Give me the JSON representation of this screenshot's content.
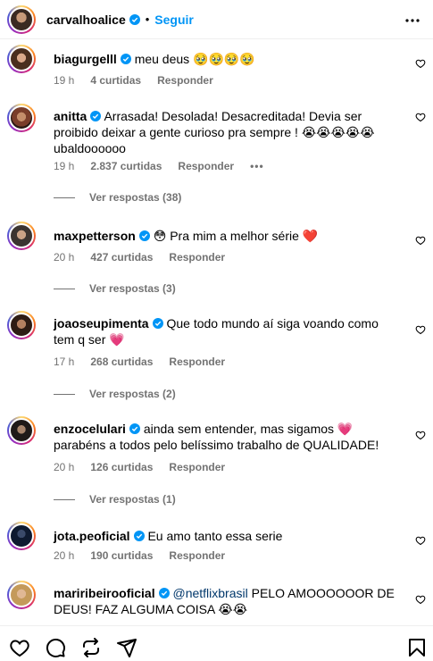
{
  "header": {
    "username": "carvalhoalice",
    "follow_label": "Seguir",
    "separator": "•"
  },
  "comments": [
    {
      "username": "biagurgelll",
      "text": "meu deus 🥹🥹🥹🥹",
      "time": "19 h",
      "likes": "4 curtidas",
      "reply_label": "Responder"
    },
    {
      "username": "anitta",
      "text": "Arrasada! Desolada! Desacreditada! Devia ser proibido deixar a gente curioso pra sempre ! 😭😭😭😭😭 ubaldoooooo",
      "time": "19 h",
      "likes": "2.837 curtidas",
      "reply_label": "Responder",
      "more": "•••",
      "replies": "Ver respostas (38)"
    },
    {
      "username": "maxpetterson",
      "text": "😳 Pra mim a melhor série ❤️",
      "time": "20 h",
      "likes": "427 curtidas",
      "reply_label": "Responder",
      "replies": "Ver respostas (3)"
    },
    {
      "username": "joaoseupimenta",
      "text": "Que todo mundo aí siga voando como tem q ser 💗",
      "time": "17 h",
      "likes": "268 curtidas",
      "reply_label": "Responder",
      "replies": "Ver respostas (2)"
    },
    {
      "username": "enzocelulari",
      "text": "ainda sem entender, mas sigamos 💗 parabéns a todos pelo belíssimo trabalho de QUALIDADE!",
      "time": "20 h",
      "likes": "126 curtidas",
      "reply_label": "Responder",
      "replies": "Ver respostas (1)"
    },
    {
      "username": "jota.peoficial",
      "text": "Eu amo tanto essa serie",
      "time": "20 h",
      "likes": "190 curtidas",
      "reply_label": "Responder"
    },
    {
      "username": "mariribeirooficial",
      "mention": "@netflixbrasil",
      "text": " PELO AMOOOOOOR DE DEUS! FAZ ALGUMA COISA 😭😭"
    }
  ],
  "colors": {
    "accent": "#0095f6",
    "verified": "#0095f6",
    "muted": "#737373"
  },
  "icons": [
    "more-icon",
    "heart-icon",
    "comment-icon",
    "share-icon",
    "send-icon",
    "bookmark-icon",
    "verified-icon"
  ]
}
